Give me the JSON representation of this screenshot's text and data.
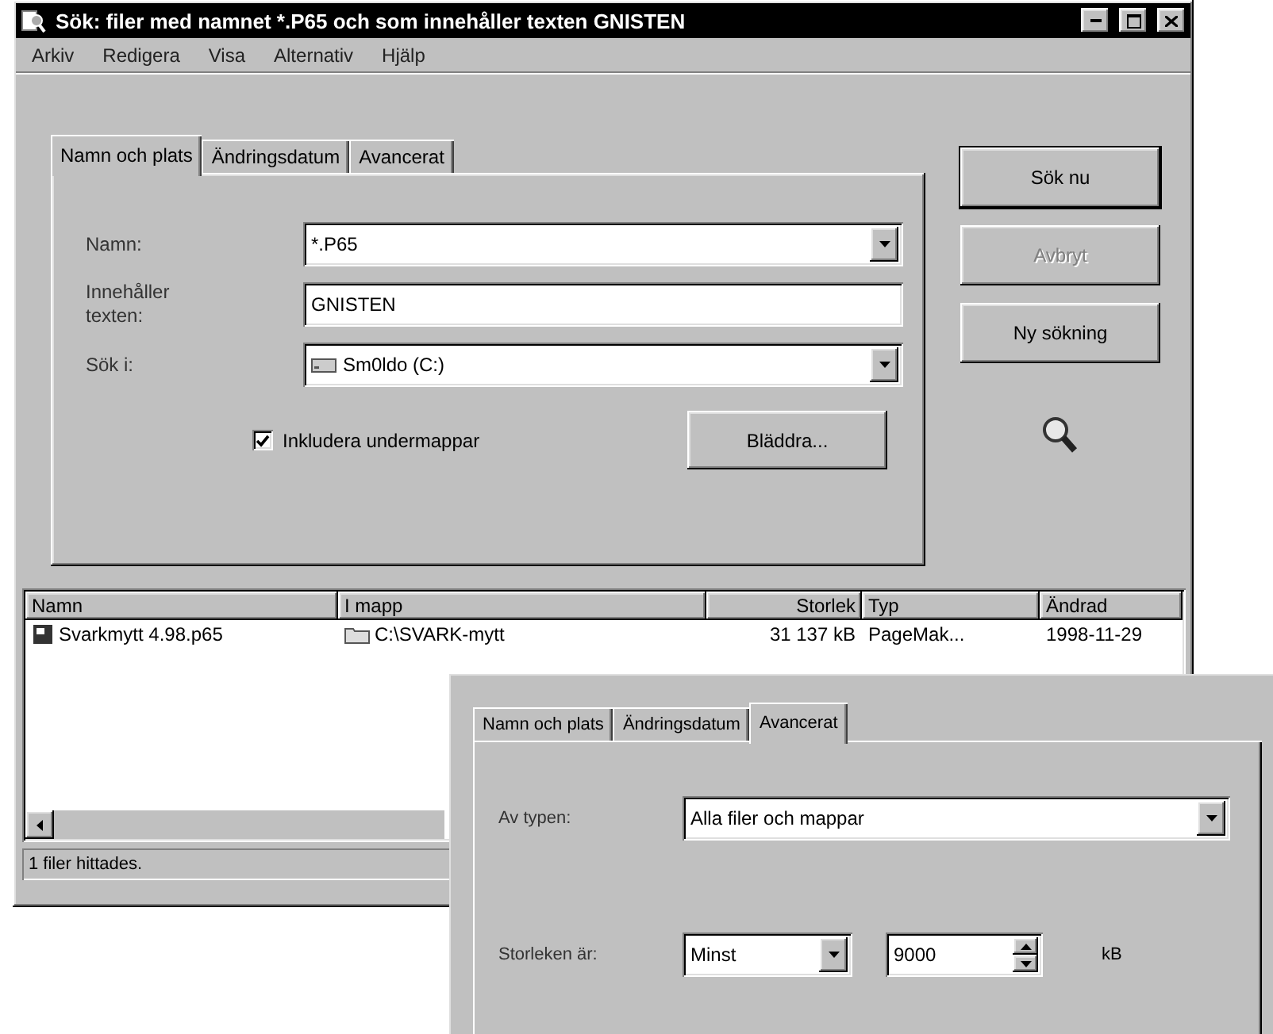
{
  "window": {
    "title": "Sök: filer med namnet *.P65 och som innehåller texten GNISTEN"
  },
  "menu": [
    "Arkiv",
    "Redigera",
    "Visa",
    "Alternativ",
    "Hjälp"
  ],
  "tabs": [
    {
      "label": "Namn och plats",
      "selected": true
    },
    {
      "label": "Ändringsdatum",
      "selected": false
    },
    {
      "label": "Avancerat",
      "selected": false
    }
  ],
  "form": {
    "name": {
      "label": "Namn:",
      "value": "*.P65"
    },
    "contains": {
      "label": "Innehåller texten:",
      "value": "GNISTEN"
    },
    "look_in": {
      "label": "Sök i:",
      "value": "Sm0ldo (C:)"
    },
    "subfolders": {
      "label": "Inkludera undermappar",
      "checked": true
    },
    "browse": "Bläddra..."
  },
  "buttons": [
    {
      "label": "Sök nu",
      "disabled": false,
      "default": true
    },
    {
      "label": "Avbryt",
      "disabled": true,
      "default": false
    },
    {
      "label": "Ny sökning",
      "disabled": false,
      "default": false
    }
  ],
  "results": {
    "columns": [
      "Namn",
      "I mapp",
      "Storlek",
      "Typ",
      "Ändrad"
    ],
    "rows": [
      [
        "Svarkmytt 4.98.p65",
        "C:\\SVARK-mytt",
        "31 137 kB",
        "PageMak...",
        "1998-11-29"
      ]
    ]
  },
  "status_bar": "1 filer hittades.",
  "overlay": {
    "tabs": [
      {
        "label": "Namn och plats",
        "selected": false
      },
      {
        "label": "Ändringsdatum",
        "selected": false
      },
      {
        "label": "Avancerat",
        "selected": true
      }
    ],
    "type": {
      "label": "Av typen:",
      "value": "Alla filer och mappar"
    },
    "size": {
      "label": "Storleken är:",
      "mode": "Minst",
      "value": "9000",
      "unit": "kB"
    }
  }
}
